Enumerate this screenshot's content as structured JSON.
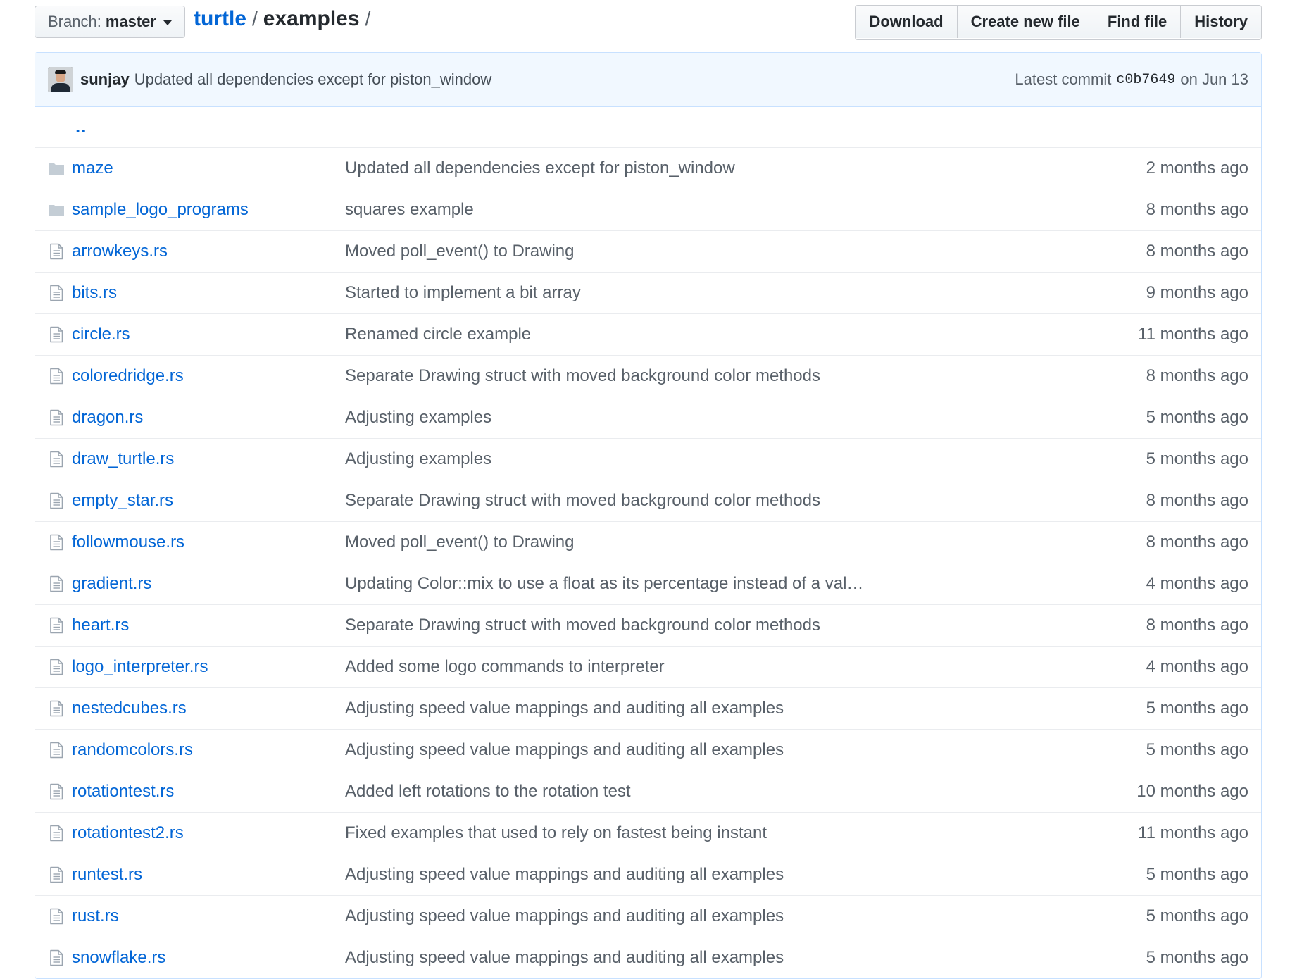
{
  "header": {
    "branch_prefix": "Branch:",
    "branch_name": "master",
    "repo": "turtle",
    "sep1": "/",
    "dir": "examples",
    "sep2": "/",
    "buttons": [
      "Download",
      "Create new file",
      "Find file",
      "History"
    ]
  },
  "commit": {
    "author": "sunjay",
    "message": "Updated all dependencies except for piston_window",
    "latest_label": "Latest commit",
    "sha": "c0b7649",
    "date": "on Jun 13"
  },
  "up_label": "..",
  "files": [
    {
      "type": "dir",
      "name": "maze",
      "message": "Updated all dependencies except for piston_window",
      "age": "2 months ago"
    },
    {
      "type": "dir",
      "name": "sample_logo_programs",
      "message": "squares example",
      "age": "8 months ago"
    },
    {
      "type": "file",
      "name": "arrowkeys.rs",
      "message": "Moved poll_event() to Drawing",
      "age": "8 months ago"
    },
    {
      "type": "file",
      "name": "bits.rs",
      "message": "Started to implement a bit array",
      "age": "9 months ago"
    },
    {
      "type": "file",
      "name": "circle.rs",
      "message": "Renamed circle example",
      "age": "11 months ago"
    },
    {
      "type": "file",
      "name": "coloredridge.rs",
      "message": "Separate Drawing struct with moved background color methods",
      "age": "8 months ago"
    },
    {
      "type": "file",
      "name": "dragon.rs",
      "message": "Adjusting examples",
      "age": "5 months ago"
    },
    {
      "type": "file",
      "name": "draw_turtle.rs",
      "message": "Adjusting examples",
      "age": "5 months ago"
    },
    {
      "type": "file",
      "name": "empty_star.rs",
      "message": "Separate Drawing struct with moved background color methods",
      "age": "8 months ago"
    },
    {
      "type": "file",
      "name": "followmouse.rs",
      "message": "Moved poll_event() to Drawing",
      "age": "8 months ago"
    },
    {
      "type": "file",
      "name": "gradient.rs",
      "message": "Updating Color::mix to use a float as its percentage instead of a val…",
      "age": "4 months ago"
    },
    {
      "type": "file",
      "name": "heart.rs",
      "message": "Separate Drawing struct with moved background color methods",
      "age": "8 months ago"
    },
    {
      "type": "file",
      "name": "logo_interpreter.rs",
      "message": "Added some logo commands to interpreter",
      "age": "4 months ago"
    },
    {
      "type": "file",
      "name": "nestedcubes.rs",
      "message": "Adjusting speed value mappings and auditing all examples",
      "age": "5 months ago"
    },
    {
      "type": "file",
      "name": "randomcolors.rs",
      "message": "Adjusting speed value mappings and auditing all examples",
      "age": "5 months ago"
    },
    {
      "type": "file",
      "name": "rotationtest.rs",
      "message": "Added left rotations to the rotation test",
      "age": "10 months ago"
    },
    {
      "type": "file",
      "name": "rotationtest2.rs",
      "message": "Fixed examples that used to rely on fastest being instant",
      "age": "11 months ago"
    },
    {
      "type": "file",
      "name": "runtest.rs",
      "message": "Adjusting speed value mappings and auditing all examples",
      "age": "5 months ago"
    },
    {
      "type": "file",
      "name": "rust.rs",
      "message": "Adjusting speed value mappings and auditing all examples",
      "age": "5 months ago"
    },
    {
      "type": "file",
      "name": "snowflake.rs",
      "message": "Adjusting speed value mappings and auditing all examples",
      "age": "5 months ago"
    }
  ],
  "colors": {
    "link": "#0366d6",
    "muted": "#586069",
    "commit_bg": "#f1f8ff",
    "border": "#c8e1ff",
    "icon": "#9ba5b0",
    "folder": "#c4cdd5"
  },
  "icons": {
    "dir": "folder-icon",
    "file": "file-icon"
  }
}
